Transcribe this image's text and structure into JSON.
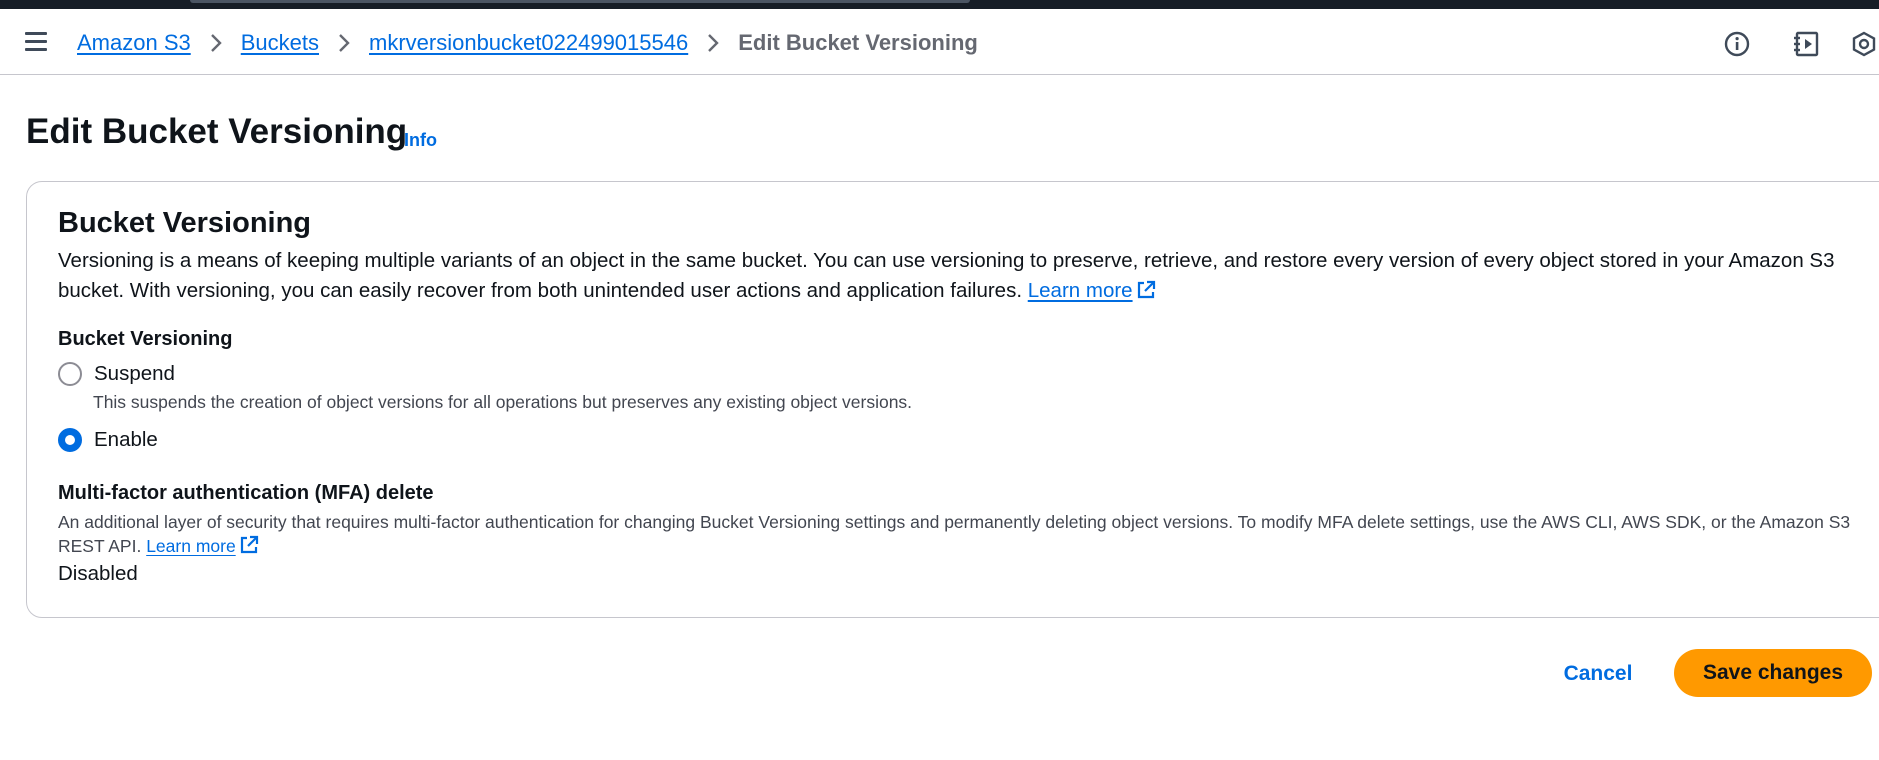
{
  "header": {
    "breadcrumb": [
      {
        "label": "Amazon S3"
      },
      {
        "label": "Buckets"
      },
      {
        "label": "mkrversionbucket022499015546"
      }
    ],
    "current": "Edit Bucket Versioning",
    "icons": [
      "info-circle-icon",
      "play-panel-icon",
      "settings-hex-icon"
    ]
  },
  "page": {
    "title": "Edit Bucket Versioning",
    "info_label": "Info"
  },
  "card": {
    "title": "Bucket Versioning",
    "description": "Versioning is a means of keeping multiple variants of an object in the same bucket. You can use versioning to preserve, retrieve, and restore every version of every object stored in your Amazon S3 bucket. With versioning, you can easily recover from both unintended user actions and application failures.",
    "learn_more": "Learn more",
    "field_label": "Bucket Versioning",
    "options": [
      {
        "label": "Suspend",
        "description": "This suspends the creation of object versions for all operations but preserves any existing object versions.",
        "selected": false
      },
      {
        "label": "Enable",
        "selected": true
      }
    ],
    "mfa": {
      "label": "Multi-factor authentication (MFA) delete",
      "description": "An additional layer of security that requires multi-factor authentication for changing Bucket Versioning settings and permanently deleting object versions. To modify MFA delete settings, use the AWS CLI, AWS SDK, or the Amazon S3 REST API.",
      "learn_more": "Learn more",
      "value": "Disabled"
    }
  },
  "actions": {
    "cancel": "Cancel",
    "save": "Save changes"
  },
  "colors": {
    "link": "#006ce0",
    "primary_button": "#ff9900",
    "topbar": "#161d26"
  }
}
